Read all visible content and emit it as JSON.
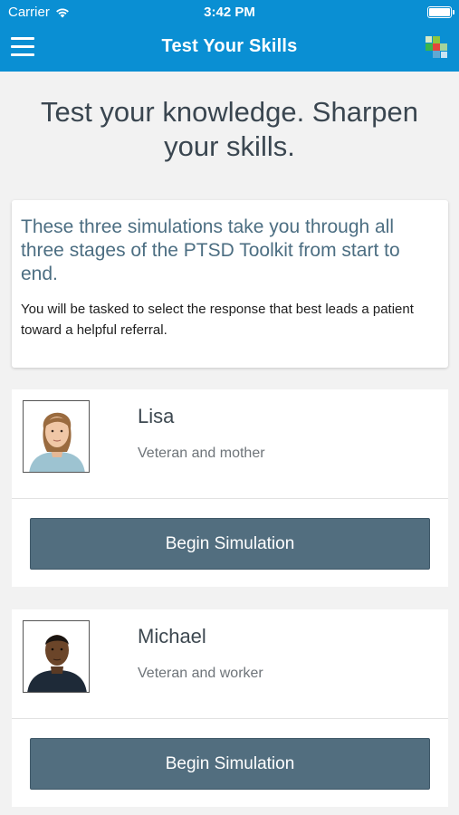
{
  "status_bar": {
    "carrier": "Carrier",
    "time": "3:42 PM"
  },
  "nav": {
    "title": "Test Your Skills"
  },
  "headline": "Test your knowledge. Sharpen your skills.",
  "intro": {
    "lead": "These three simulations take you through all three stages of the PTSD Toolkit from start to end.",
    "body": "You will be tasked to select the response that best leads a patient toward a helpful referral."
  },
  "simulations": [
    {
      "name": "Lisa",
      "description": "Veteran and mother",
      "button_label": "Begin Simulation"
    },
    {
      "name": "Michael",
      "description": "Veteran and worker",
      "button_label": "Begin Simulation"
    }
  ],
  "colors": {
    "brand_blue": "#0a8fd3",
    "button": "#526e7f"
  }
}
